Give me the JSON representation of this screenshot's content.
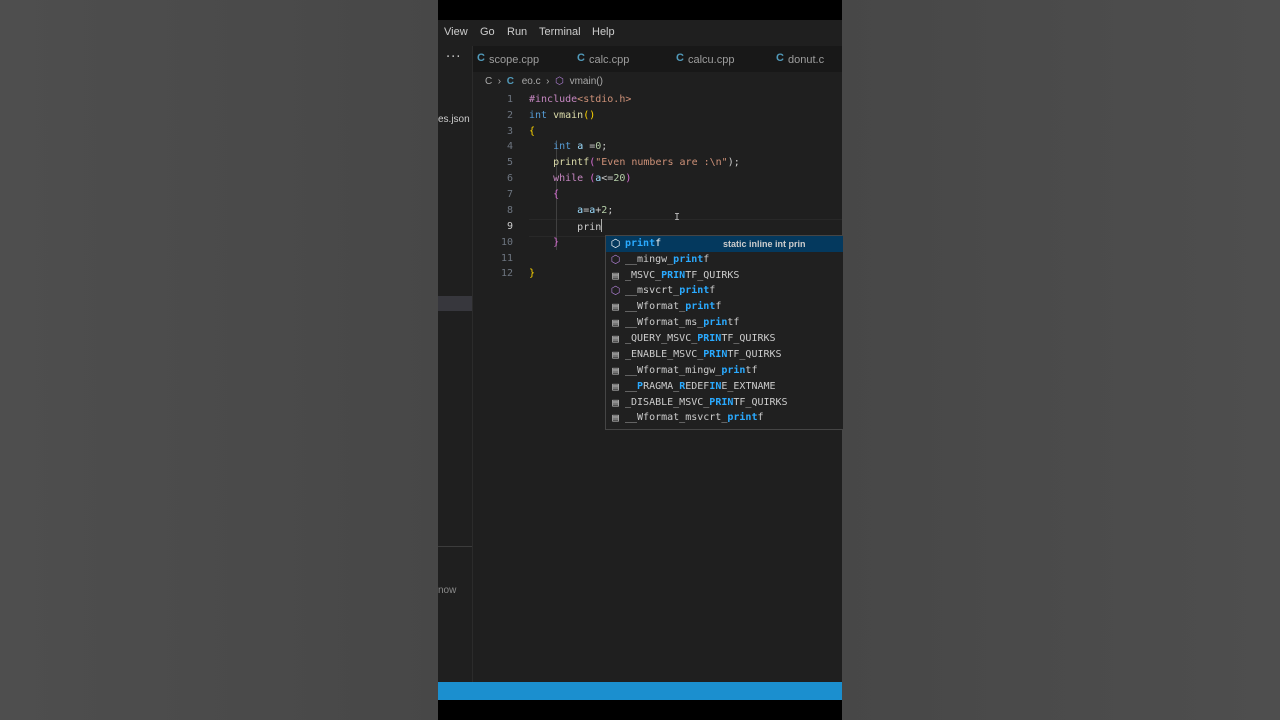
{
  "menu": [
    "View",
    "Go",
    "Run",
    "Terminal",
    "Help"
  ],
  "tabs": [
    {
      "icon": "C",
      "name": "scope.cpp"
    },
    {
      "icon": "C",
      "name": "calc.cpp"
    },
    {
      "icon": "C",
      "name": "calcu.cpp"
    },
    {
      "icon": "C",
      "name": "donut.c"
    }
  ],
  "sidebar": {
    "more": "···",
    "file_fragment": "es.json",
    "status_fragment": "now"
  },
  "breadcrumb": {
    "folder": "C",
    "file_icon": "C",
    "file": "eo.c",
    "symbol": "vmain()"
  },
  "editor": {
    "line_numbers": [
      "1",
      "2",
      "3",
      "4",
      "5",
      "6",
      "7",
      "8",
      "9",
      "10",
      "11",
      "12"
    ],
    "active_line": 9,
    "typed": "prin",
    "code": {
      "l1_pp": "#include",
      "l1_inc": "<stdio.h>",
      "l2_type": "int",
      "l2_fn": "vmain",
      "l2_paren": "()",
      "l3": "{",
      "l4_type": "int",
      "l4_var": "a",
      "l4_eq": " =",
      "l4_num": "0",
      "l4_end": ";",
      "l5_fn": "printf",
      "l5_open": "(",
      "l5_str": "\"Even numbers are :\\n\"",
      "l5_end": ");",
      "l6_kw": "while",
      "l6_open": " (",
      "l6_var": "a",
      "l6_op": "<=",
      "l6_num": "20",
      "l6_close": ")",
      "l7": "{",
      "l8_var1": "a",
      "l8_eq": "=",
      "l8_var2": "a",
      "l8_plus": "+",
      "l8_num": "2",
      "l8_end": ";",
      "l10": "}",
      "l12": "}"
    }
  },
  "suggestions": [
    {
      "icon": "method",
      "pre": "",
      "hl": "print",
      "post": "f",
      "detail": "static inline int prin",
      "selected": true
    },
    {
      "icon": "method",
      "pre": "__mingw_",
      "hl": "print",
      "post": "f"
    },
    {
      "icon": "macro",
      "pre": "_MSVC_",
      "hl": "PRIN",
      "post": "TF_QUIRKS"
    },
    {
      "icon": "method",
      "pre": "__msvcrt_",
      "hl": "print",
      "post": "f"
    },
    {
      "icon": "macro",
      "pre": "__Wformat_",
      "hl": "print",
      "post": "f"
    },
    {
      "icon": "macro",
      "pre": "__Wformat_ms_",
      "hl": "prin",
      "post": "tf"
    },
    {
      "icon": "macro",
      "pre": "_QUERY_MSVC_",
      "hl": "PRIN",
      "post": "TF_QUIRKS"
    },
    {
      "icon": "macro",
      "pre": "_ENABLE_MSVC_",
      "hl": "PRIN",
      "post": "TF_QUIRKS"
    },
    {
      "icon": "macro",
      "pre": "__Wformat_mingw_",
      "hl": "prin",
      "post": "tf"
    },
    {
      "icon": "macro",
      "pre": "__",
      "hl": "P",
      "post": "RAGMA_",
      "hl2": "R",
      "post2": "EDEF",
      "hl3": "IN",
      "post3": "E_EXTNAME"
    },
    {
      "icon": "macro",
      "pre": "_DISABLE_MSVC_",
      "hl": "PRIN",
      "post": "TF_QUIRKS"
    },
    {
      "icon": "macro",
      "pre": "__Wformat_msvcrt_",
      "hl": "print",
      "post": "f"
    }
  ],
  "colors": {
    "status_bar": "#1b8fcf",
    "editor_bg": "#1f1f1f",
    "selection": "#04395e"
  }
}
